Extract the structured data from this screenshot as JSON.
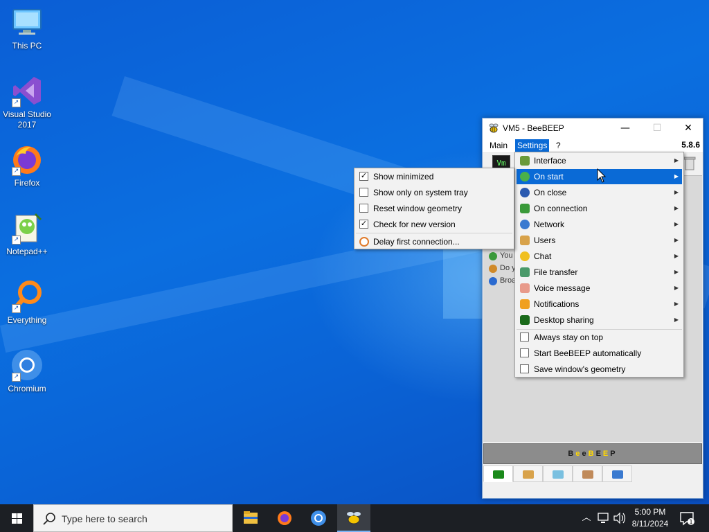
{
  "desktop": {
    "icons": [
      {
        "label": "This PC"
      },
      {
        "label": "Visual Studio 2017"
      },
      {
        "label": "Firefox"
      },
      {
        "label": "Notepad++"
      },
      {
        "label": "Everything"
      },
      {
        "label": "Chromium"
      }
    ]
  },
  "window": {
    "title": "VM5 - BeeBEEP",
    "minimize": "—",
    "maximize": "☐",
    "close": "✕",
    "version": "5.8.6",
    "vm_badge": "Vm",
    "menu": {
      "main": "Main",
      "settings": "Settings",
      "help": "?"
    },
    "chat_lines": [
      "You",
      "Do y",
      "Broa"
    ],
    "bee_bar": [
      "B",
      "e",
      "e",
      "B",
      "E",
      "E",
      "P"
    ]
  },
  "settings_menu": {
    "items": [
      {
        "label": "Interface",
        "submenu": true
      },
      {
        "label": "On start",
        "submenu": true,
        "highlighted": true
      },
      {
        "label": "On close",
        "submenu": true
      },
      {
        "label": "On connection",
        "submenu": true
      },
      {
        "label": "Network",
        "submenu": true
      },
      {
        "label": "Users",
        "submenu": true
      },
      {
        "label": "Chat",
        "submenu": true
      },
      {
        "label": "File transfer",
        "submenu": true
      },
      {
        "label": "Voice message",
        "submenu": true
      },
      {
        "label": "Notifications",
        "submenu": true
      },
      {
        "label": "Desktop sharing",
        "submenu": true
      }
    ],
    "checks": [
      {
        "label": "Always stay on top",
        "checked": false
      },
      {
        "label": "Start BeeBEEP automatically",
        "checked": false
      }
    ],
    "save_geometry": "Save window's geometry"
  },
  "on_start_submenu": {
    "items": [
      {
        "label": "Show minimized",
        "checked": true
      },
      {
        "label": "Show only on system tray",
        "checked": false
      },
      {
        "label": "Reset window geometry",
        "checked": false
      },
      {
        "label": "Check for new version",
        "checked": true
      }
    ],
    "delay": "Delay first connection..."
  },
  "taskbar": {
    "search_placeholder": "Type here to search",
    "time": "5:00 PM",
    "date": "8/11/2024",
    "notification_count": "1"
  },
  "colors": {
    "highlight": "#0a6ad6",
    "taskbar": "#1c1f24"
  }
}
